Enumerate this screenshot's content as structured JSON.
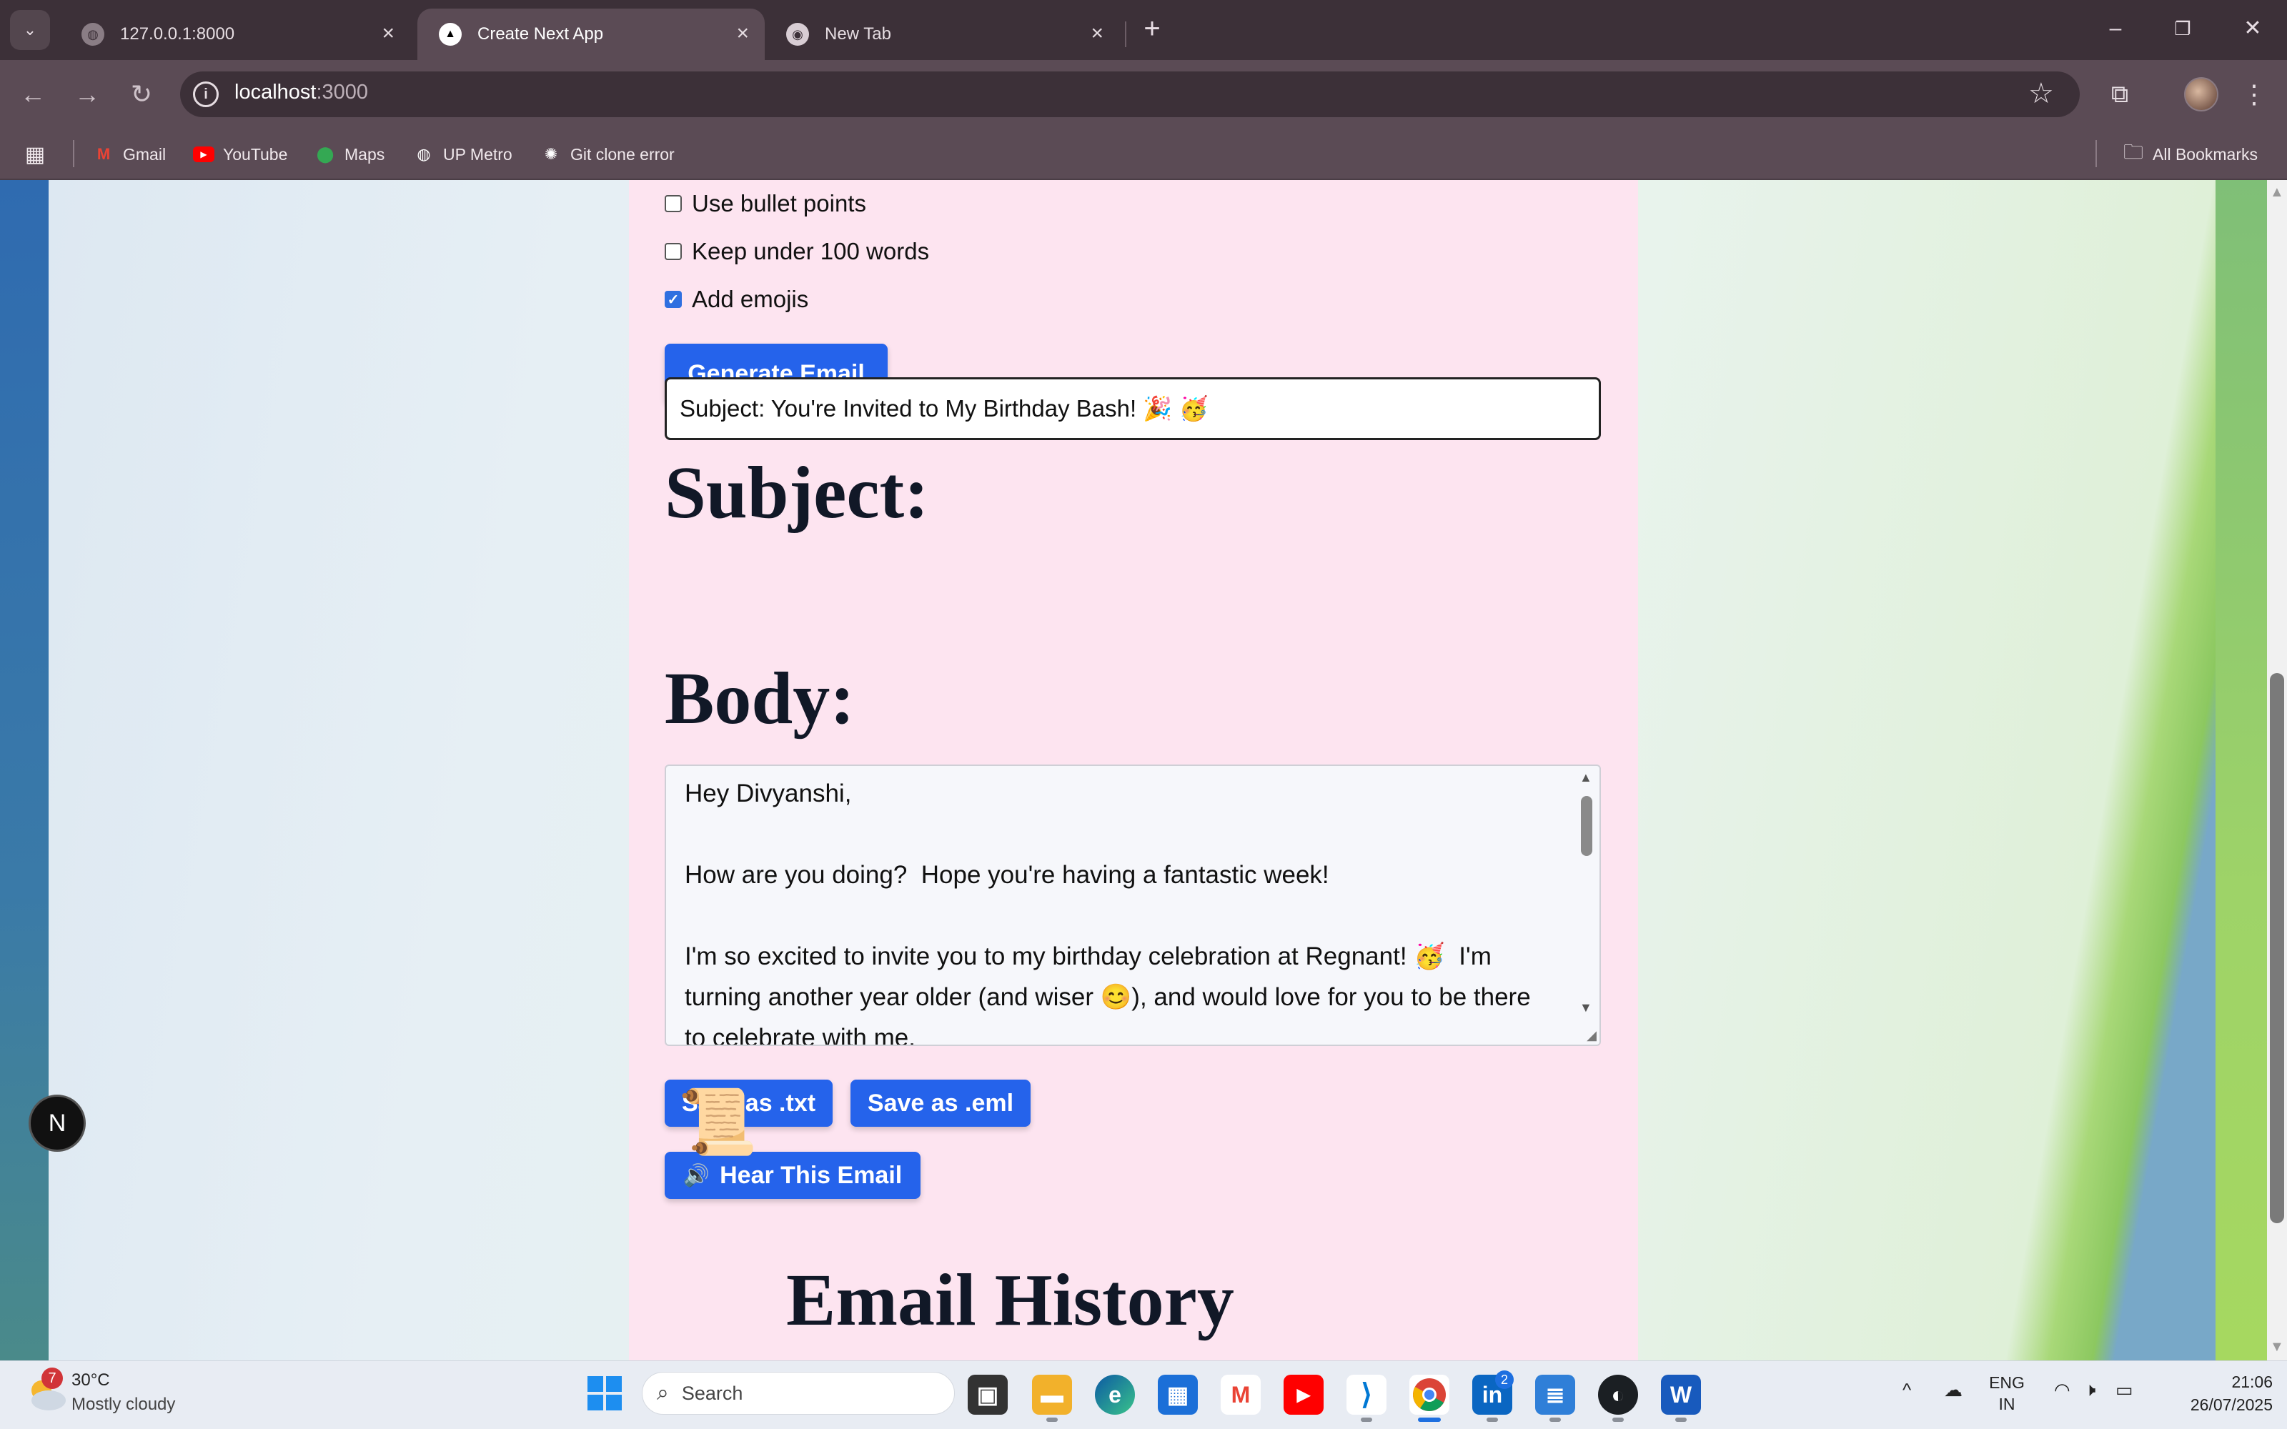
{
  "browser": {
    "tabs": [
      {
        "title": "127.0.0.1:8000",
        "active": false
      },
      {
        "title": "Create Next App",
        "active": true
      },
      {
        "title": "New Tab",
        "active": false
      }
    ],
    "address": {
      "host": "localhost",
      "port": ":3000"
    },
    "bookmarks": [
      {
        "label": "Gmail",
        "icon": "gmail-icon"
      },
      {
        "label": "YouTube",
        "icon": "youtube-icon"
      },
      {
        "label": "Maps",
        "icon": "maps-icon"
      },
      {
        "label": "UP Metro",
        "icon": "globe-icon"
      },
      {
        "label": "Git clone error",
        "icon": "openai-icon"
      }
    ],
    "all_bookmarks": "All Bookmarks"
  },
  "form": {
    "options": [
      {
        "label": "Use bullet points",
        "checked": false
      },
      {
        "label": "Keep under 100 words",
        "checked": false
      },
      {
        "label": "Add emojis",
        "checked": true
      }
    ],
    "generate_label": "Generate Email"
  },
  "subject": {
    "heading": "Subject:",
    "value": "Subject: You're Invited to My Birthday Bash! 🎉 🥳"
  },
  "body": {
    "heading": "Body:",
    "value": "Hey Divyanshi,\n\nHow are you doing?  Hope you're having a fantastic week!\n\nI'm so excited to invite you to my birthday celebration at Regnant! 🥳  I'm turning another year older (and wiser 😊), and would love for you to be there to celebrate with me."
  },
  "actions": {
    "save_txt": "Save as .txt",
    "save_eml": "Save as .eml",
    "hear": "Hear This Email",
    "hear_icon": "🔊"
  },
  "history": {
    "heading": "Email History",
    "icon": "📜"
  },
  "nextjs_badge": "N",
  "taskbar": {
    "weather_temp": "30°C",
    "weather_desc": "Mostly cloudy",
    "weather_badge": "7",
    "search_placeholder": "Search",
    "linkedin_badge": "2",
    "lang_line1": "ENG",
    "lang_line2": "IN",
    "time": "21:06",
    "date": "26/07/2025"
  },
  "colors": {
    "accent": "#2563eb",
    "card": "#fde4f0",
    "heading": "#111827"
  }
}
